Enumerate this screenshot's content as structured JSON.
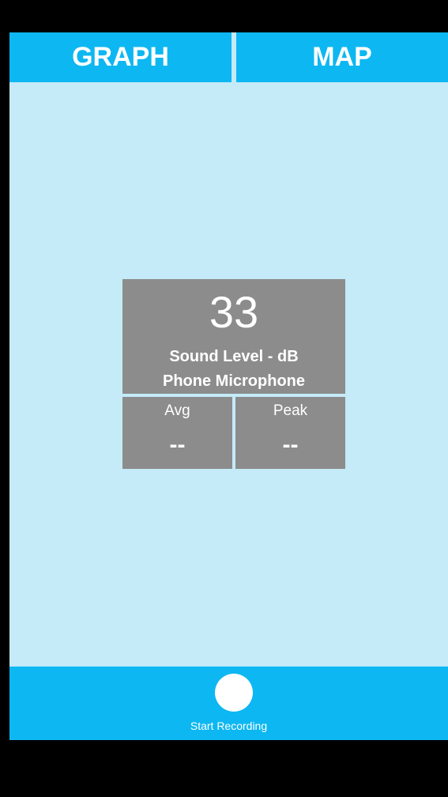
{
  "tabs": {
    "graph_label": "GRAPH",
    "map_label": "MAP"
  },
  "meter": {
    "value": "33",
    "unit_label": "Sound Level - dB",
    "source_label": "Phone Microphone"
  },
  "stats": {
    "avg_label": "Avg",
    "avg_value": "--",
    "peak_label": "Peak",
    "peak_value": "--"
  },
  "recording": {
    "button_label": "Start Recording"
  },
  "colors": {
    "accent": "#0DB7F2",
    "background": "#C5EAF8",
    "panel": "#8C8C8C"
  }
}
